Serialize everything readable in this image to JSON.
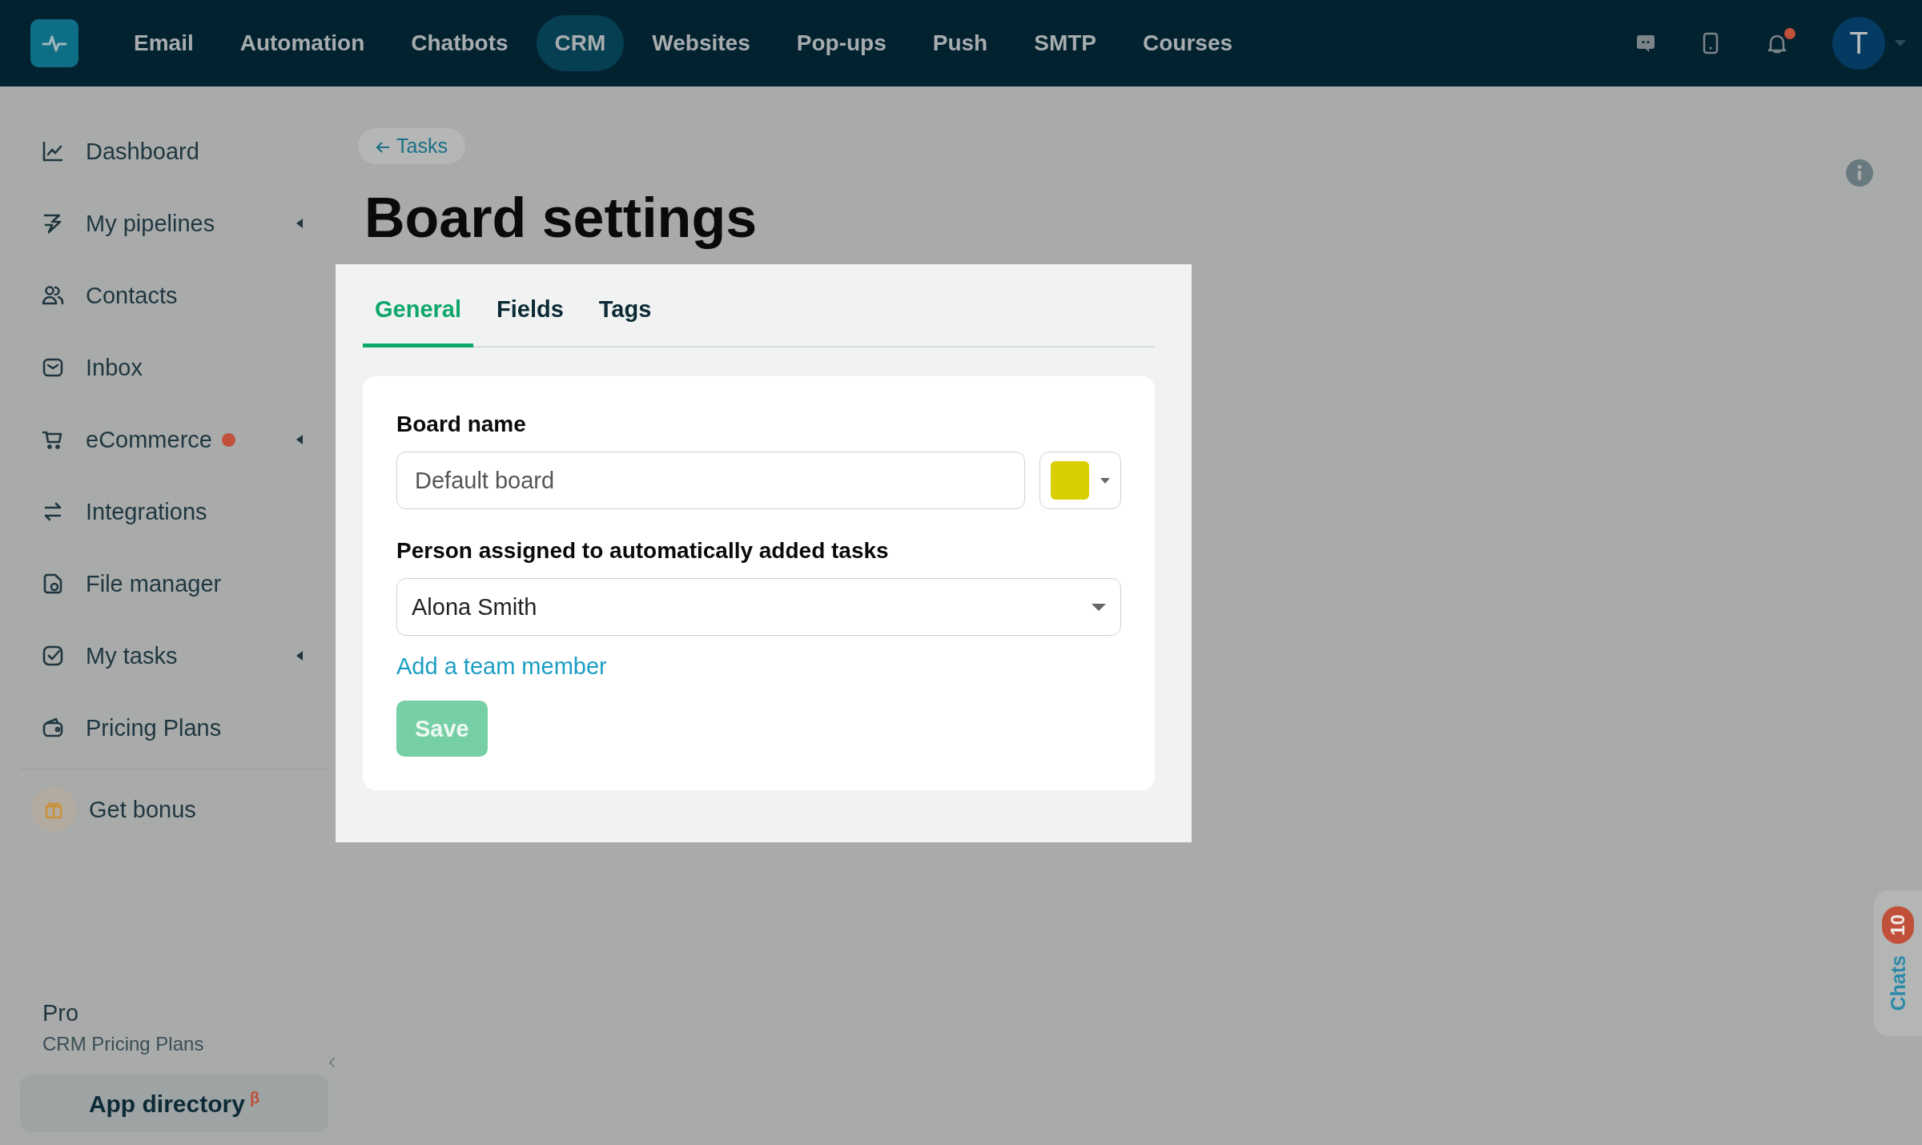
{
  "top_nav": {
    "items": [
      {
        "label": "Email",
        "selected": false
      },
      {
        "label": "Automation",
        "selected": false
      },
      {
        "label": "Chatbots",
        "selected": false
      },
      {
        "label": "CRM",
        "selected": true
      },
      {
        "label": "Websites",
        "selected": false
      },
      {
        "label": "Pop-ups",
        "selected": false
      },
      {
        "label": "Push",
        "selected": false
      },
      {
        "label": "SMTP",
        "selected": false
      },
      {
        "label": "Courses",
        "selected": false
      }
    ],
    "notifications_unread": true,
    "avatar_letter": "T"
  },
  "sidebar": {
    "items": [
      {
        "label": "Dashboard",
        "expandable": false,
        "alert": false
      },
      {
        "label": "My pipelines",
        "expandable": true,
        "alert": false
      },
      {
        "label": "Contacts",
        "expandable": false,
        "alert": false
      },
      {
        "label": "Inbox",
        "expandable": false,
        "alert": false
      },
      {
        "label": "eCommerce",
        "expandable": true,
        "alert": true
      },
      {
        "label": "Integrations",
        "expandable": false,
        "alert": false
      },
      {
        "label": "File manager",
        "expandable": false,
        "alert": false
      },
      {
        "label": "My tasks",
        "expandable": true,
        "alert": false
      },
      {
        "label": "Pricing Plans",
        "expandable": false,
        "alert": false
      }
    ],
    "bonus": "Get bonus",
    "plan": "Pro",
    "plan_subtitle": "CRM Pricing Plans",
    "app_directory": "App directory",
    "app_directory_mark": "β"
  },
  "back_link": "Tasks",
  "title": "Board settings",
  "tabs": [
    {
      "label": "General",
      "selected": true
    },
    {
      "label": "Fields",
      "selected": false
    },
    {
      "label": "Tags",
      "selected": false
    }
  ],
  "form": {
    "board_name_label": "Board name",
    "board_name_value": "Default board",
    "assignee_label": "Person assigned to automatically added tasks",
    "assignee_value": "Alona Smith",
    "add_member_link": "Add a team member",
    "save_button": "Save",
    "save_disabled": true
  },
  "chats": {
    "label": "Chats",
    "count": "10"
  }
}
